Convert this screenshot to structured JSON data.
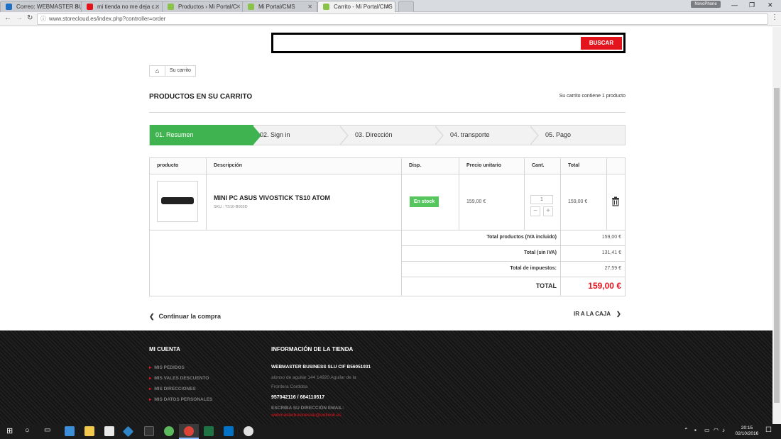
{
  "browser": {
    "tabs": [
      {
        "title": "Correo: WEBMASTER BU",
        "color": "#1e6fc6"
      },
      {
        "title": "mi tienda no me deja c...",
        "color": "#e3141c"
      },
      {
        "title": "Productos › Mi Portal/C",
        "color": "#8bc34a"
      },
      {
        "title": "Mi Portal/CMS",
        "color": "#8bc34a"
      },
      {
        "title": "Carrito - Mi Portal/CMS",
        "color": "#8bc34a"
      }
    ],
    "user_chip": "NovoPhone",
    "url": "www.storecloud.es/index.php?controller=order"
  },
  "search": {
    "placeholder": "",
    "button": "BUSCAR"
  },
  "breadcrumb": {
    "current": "Su carrito"
  },
  "page": {
    "title": "PRODUCTOS EN SU CARRITO",
    "count": "Su carrito contiene 1 producto"
  },
  "steps": [
    "01. Resumen",
    "02. Sign in",
    "03. Dirección",
    "04. transporte",
    "05. Pago"
  ],
  "table": {
    "headers": [
      "producto",
      "Descripción",
      "Disp.",
      "Precio unitario",
      "Cant.",
      "Total"
    ],
    "item": {
      "name": "MINI PC ASUS VIVOSTICK TS10 ATOM",
      "sku": "SKU : TS10-B003D",
      "stock": "En stock",
      "unit_price": "159,00 €",
      "qty": "1",
      "total": "159,00 €"
    },
    "summary": [
      {
        "label": "Total productos (IVA incluido)",
        "value": "159,00 €"
      },
      {
        "label": "Total (sin IVA)",
        "value": "131,41 €"
      },
      {
        "label": "Total de impuestos:",
        "value": "27,59 €"
      }
    ],
    "grand_label": "TOTAL",
    "grand_value": "159,00 €"
  },
  "nav": {
    "continue": "Continuar la compra",
    "checkout": "IR A LA CAJA"
  },
  "footer": {
    "account_title": "MI CUENTA",
    "account_links": [
      "MIS PEDIDOS",
      "MIS VALES DESCUENTO",
      "MIS DIRECCIONES",
      "MIS DATOS PERSONALES"
    ],
    "store_title": "INFORMACIÓN DE LA TIENDA",
    "company": "WEBMASTER BUSINESS SLU CIF B56051931",
    "address1": "alonso de aguilar 144 14920 Aguilar de la",
    "address2": "Frontera Cordoba",
    "phones": "957042116 / 684110517",
    "email_label": "ESCRIBA SU DIRECCIÓN EMAIL:",
    "email": "webmasterbusinesslu@outlook.es"
  },
  "taskbar": {
    "time": "20:15",
    "date": "02/10/2016"
  }
}
